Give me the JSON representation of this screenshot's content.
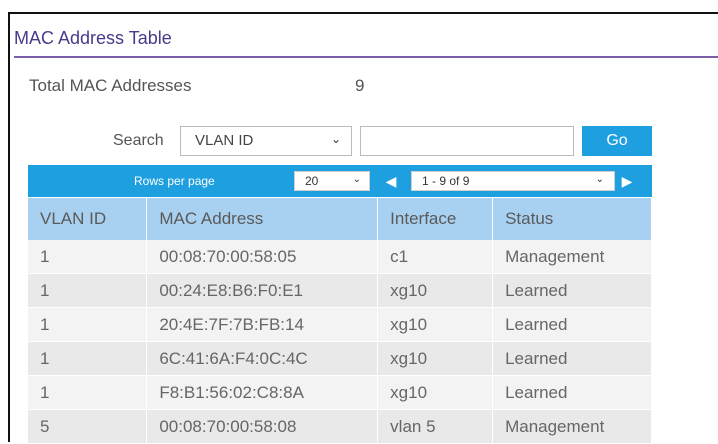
{
  "title": "MAC Address Table",
  "summary": {
    "label": "Total MAC Addresses",
    "value": "9"
  },
  "search": {
    "label": "Search",
    "field_selected": "VLAN ID",
    "input_value": "",
    "go_label": "Go"
  },
  "pager": {
    "rows_label": "Rows per page",
    "rows_selected": "20",
    "range_selected": "1 - 9 of 9"
  },
  "table": {
    "headers": [
      "VLAN ID",
      "MAC Address",
      "Interface",
      "Status"
    ],
    "rows": [
      [
        "1",
        "00:08:70:00:58:05",
        "c1",
        "Management"
      ],
      [
        "1",
        "00:24:E8:B6:F0:E1",
        "xg10",
        "Learned"
      ],
      [
        "1",
        "20:4E:7F:7B:FB:14",
        "xg10",
        "Learned"
      ],
      [
        "1",
        "6C:41:6A:F4:0C:4C",
        "xg10",
        "Learned"
      ],
      [
        "1",
        "F8:B1:56:02:C8:8A",
        "xg10",
        "Learned"
      ],
      [
        "5",
        "00:08:70:00:58:08",
        "vlan 5",
        "Management"
      ]
    ]
  },
  "colors": {
    "accent": "#1e9fdf",
    "header_bg": "#a8d0f0",
    "title": "#4a3a8a"
  }
}
